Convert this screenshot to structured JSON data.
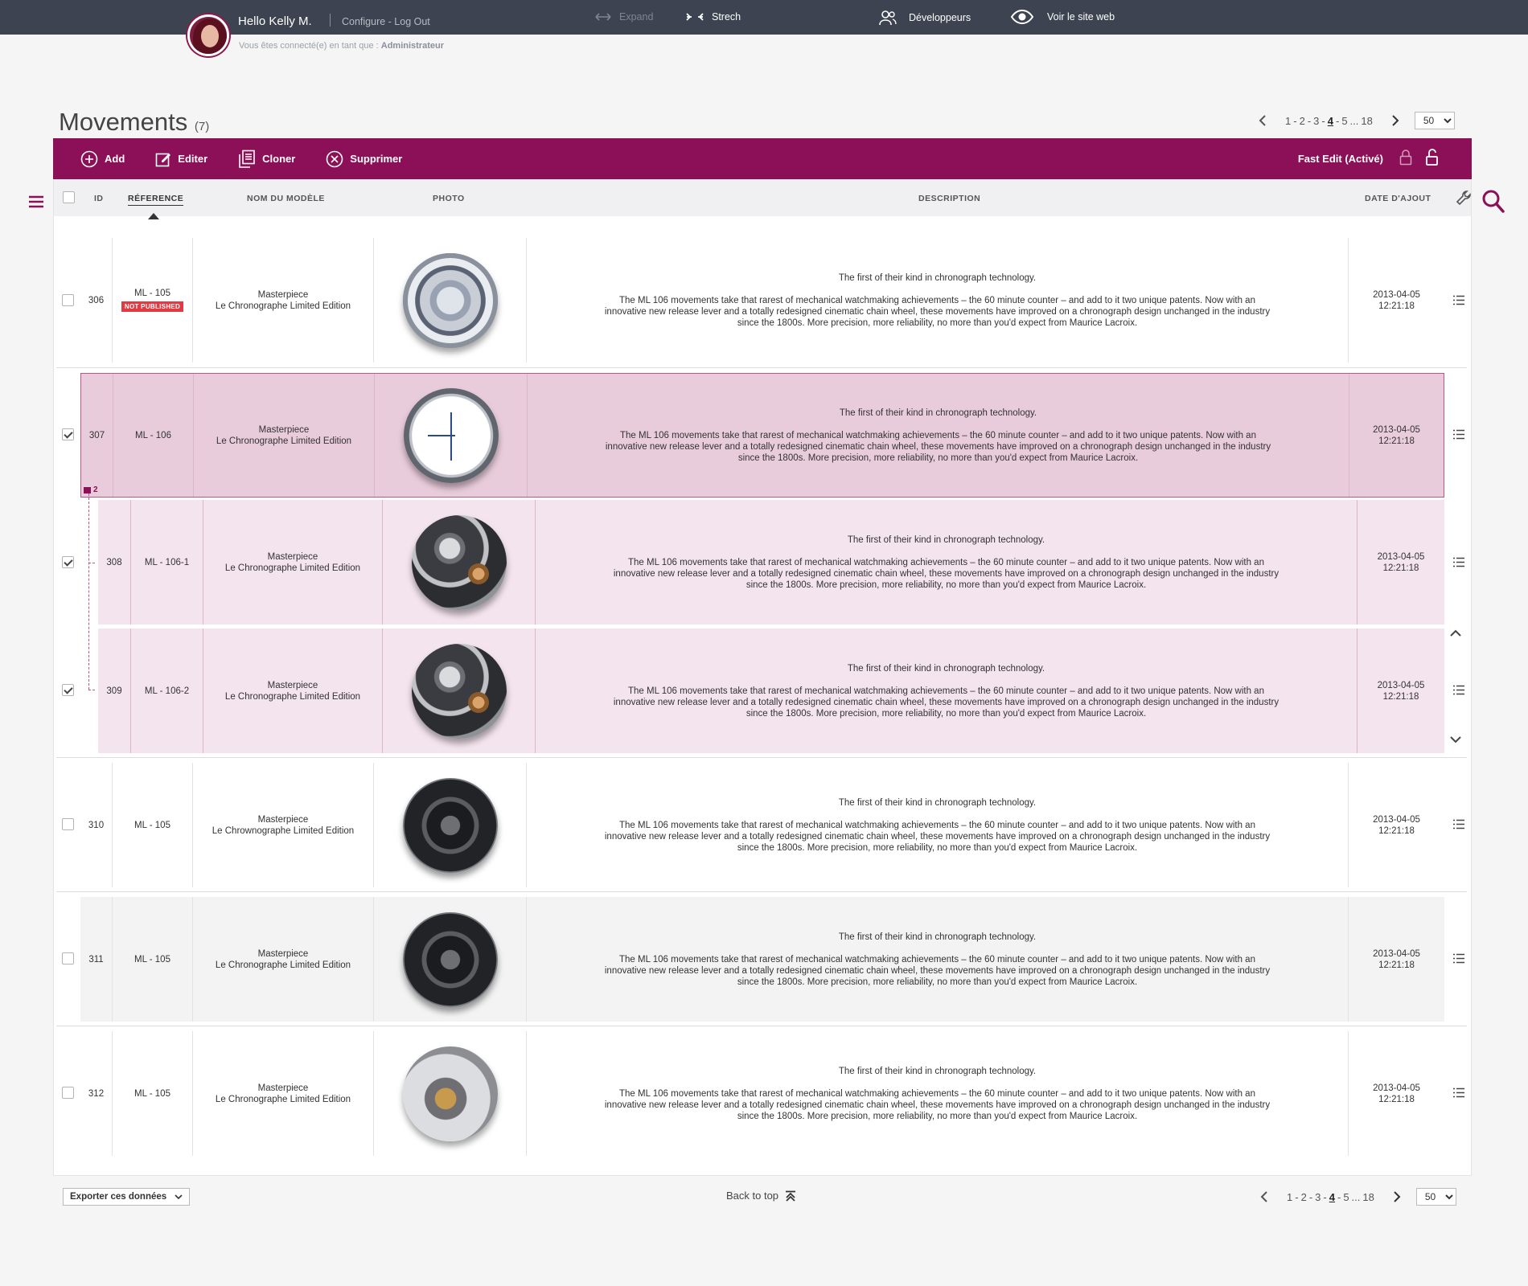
{
  "header": {
    "hello": "Hello Kelly M.",
    "links": "Configure - Log Out",
    "logged_as_prefix": "Vous êtes connecté(e) en tant que :",
    "role": "Administrateur",
    "expand": "Expand",
    "strech": "Strech",
    "developers": "Développeurs",
    "view_site": "Voir le site web"
  },
  "page": {
    "title": "Movements",
    "count": "(7)"
  },
  "pagination": {
    "pages": [
      "1",
      "-",
      "2",
      "-",
      "3",
      "-",
      "4",
      "-",
      "5",
      "...",
      "18"
    ],
    "current": "4",
    "per_page": "50"
  },
  "toolbar": {
    "add": "Add",
    "edit": "Editer",
    "clone": "Cloner",
    "delete": "Supprimer",
    "fast_edit": "Fast Edit (Activé)"
  },
  "columns": {
    "id": "ID",
    "reference": "RÉFERENCE",
    "model": "NOM DU MODÈLE",
    "photo": "PHOTO",
    "description": "DESCRIPTION",
    "date": "DATE D'AJOUT"
  },
  "rows": [
    {
      "id": "306",
      "ref": "ML - 105",
      "badge": "NOT PUBLISHED",
      "model1": "Masterpiece",
      "model2": "Le Chronographe Limited Edition",
      "desc1": "The first of their kind in chronograph technology.",
      "desc2": "The ML 106 movements take that rarest of mechanical watchmaking achievements – the 60 minute counter – and add to it two unique patents. Now with an innovative new release lever and a totally redesigned cinematic chain wheel, these movements have improved on a chronograph design unchanged in the industry since the 1800s. More precision, more reliability, no more than you'd expect from Maurice Lacroix.",
      "date": "2013-04-05",
      "time": "12:21:18"
    },
    {
      "id": "307",
      "ref": "ML - 106",
      "model1": "Masterpiece",
      "model2": "Le Chronographe Limited Edition",
      "desc1": "The first of their kind in chronograph technology.",
      "desc2": "The ML 106 movements take that rarest of mechanical watchmaking achievements – the 60 minute counter – and add to it two unique patents. Now with an innovative new release lever and a totally redesigned cinematic chain wheel, these movements have improved on a chronograph design unchanged in the industry since the 1800s. More precision, more reliability, no more than you'd expect from Maurice Lacroix.",
      "date": "2013-04-05",
      "time": "12:21:18"
    },
    {
      "id": "308",
      "ref": "ML - 106-1",
      "model1": "Masterpiece",
      "model2": "Le Chronographe Limited Edition",
      "desc1": "The first of their kind in chronograph technology.",
      "desc2": "The ML 106 movements take that rarest of mechanical watchmaking achievements – the 60 minute counter – and add to it two unique patents. Now with an innovative new release lever and a totally redesigned cinematic chain wheel, these movements have improved on a chronograph design unchanged in the industry since the 1800s. More precision, more reliability, no more than you'd expect from Maurice Lacroix.",
      "date": "2013-04-05",
      "time": "12:21:18"
    },
    {
      "id": "309",
      "ref": "ML - 106-2",
      "model1": "Masterpiece",
      "model2": "Le Chronographe Limited Edition",
      "desc1": "The first of their kind in chronograph technology.",
      "desc2": "The ML 106 movements take that rarest of mechanical watchmaking achievements – the 60 minute counter – and add to it two unique patents. Now with an innovative new release lever and a totally redesigned cinematic chain wheel, these movements have improved on a chronograph design unchanged in the industry since the 1800s. More precision, more reliability, no more than you'd expect from Maurice Lacroix.",
      "date": "2013-04-05",
      "time": "12:21:18"
    },
    {
      "id": "310",
      "ref": "ML - 105",
      "model1": "Masterpiece",
      "model2": "Le Chrownographe Limited Edition",
      "desc1": "The first of their kind in chronograph technology.",
      "desc2": "The ML 106 movements take that rarest of mechanical watchmaking achievements – the 60 minute counter – and add to it two unique patents. Now with an innovative new release lever and a totally redesigned cinematic chain wheel, these movements have improved on a chronograph design unchanged in the industry since the 1800s. More precision, more reliability, no more than you'd expect from Maurice Lacroix.",
      "date": "2013-04-05",
      "time": "12:21:18"
    },
    {
      "id": "311",
      "ref": "ML - 105",
      "model1": "Masterpiece",
      "model2": "Le Chronographe Limited Edition",
      "desc1": "The first of their kind in chronograph technology.",
      "desc2": "The ML 106 movements take that rarest of mechanical watchmaking achievements – the 60 minute counter – and add to it two unique patents. Now with an innovative new release lever and a totally redesigned cinematic chain wheel, these movements have improved on a chronograph design unchanged in the industry since the 1800s. More precision, more reliability, no more than you'd expect from Maurice Lacroix.",
      "date": "2013-04-05",
      "time": "12:21:18"
    },
    {
      "id": "312",
      "ref": "ML - 105",
      "model1": "Masterpiece",
      "model2": "Le Chronographe Limited Edition",
      "desc1": "The first of their kind in chronograph technology.",
      "desc2": "The ML 106 movements take that rarest of mechanical watchmaking achievements – the 60 minute counter – and add to it two unique patents. Now with an innovative new release lever and a totally redesigned cinematic chain wheel, these movements have improved on a chronograph design unchanged in the industry since the 1800s. More precision, more reliability, no more than you'd expect from Maurice Lacroix.",
      "date": "2013-04-05",
      "time": "12:21:18"
    }
  ],
  "children_count": "2",
  "footer": {
    "export": "Exporter ces données",
    "back_to_top": "Back to top"
  },
  "colors": {
    "accent": "#8b1057",
    "topbar": "#3d4350",
    "selected_row": "#e9ccdb",
    "child_row": "#f4e4ed",
    "badge": "#e23a43"
  }
}
